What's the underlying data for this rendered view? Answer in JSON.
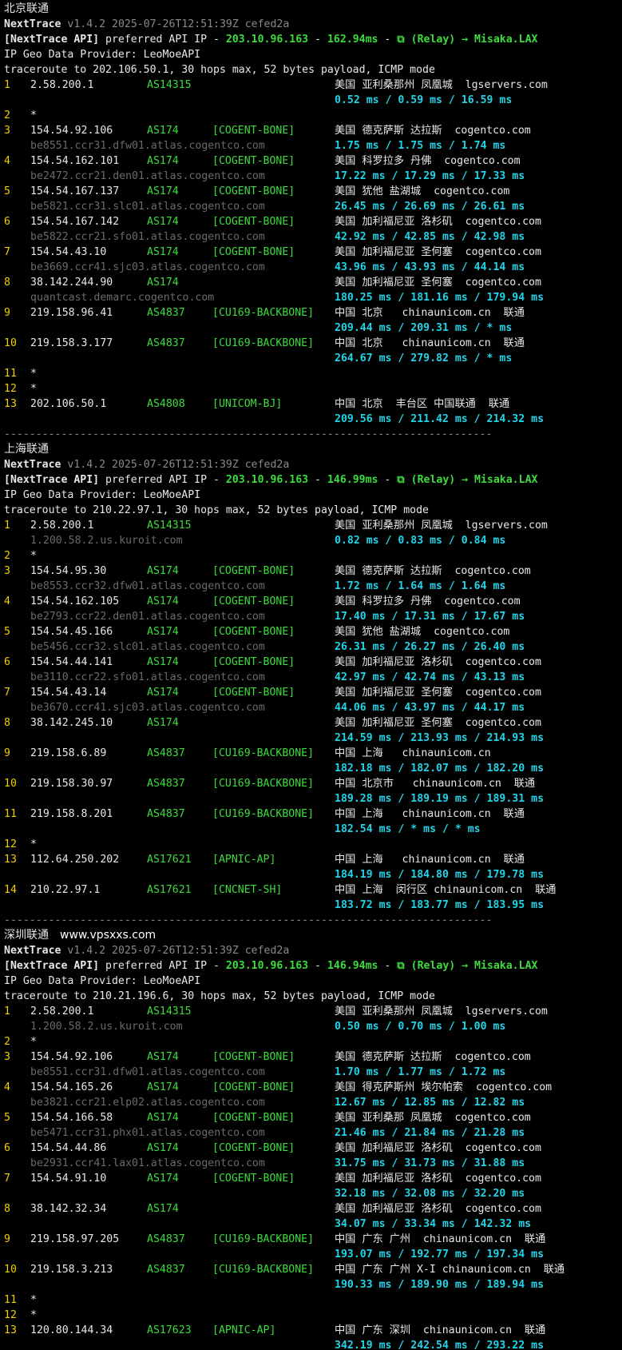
{
  "common": {
    "tool": "NextTrace",
    "version": "v1.4.2 2025-07-26T12:51:39Z cefed2a",
    "api_bracket": "[NextTrace API]",
    "api_text": " preferred API IP - ",
    "api_ip": "203.10.96.163",
    "api_dash": " - ",
    "relay": "⧉ (Relay) → Misaka.LAX",
    "geo_provider": "IP Geo Data Provider: LeoMoeAPI",
    "separator": "-----------------------------------------------------------------------------"
  },
  "sections": [
    {
      "title": "北京联通",
      "site": "",
      "latency": "162.94ms",
      "traceroute": "traceroute to 202.106.50.1, 30 hops max, 52 bytes payload, ICMP mode",
      "hops": [
        {
          "hop": "1",
          "ip": "2.58.200.1",
          "as": "AS14315",
          "tag": "",
          "geo": "美国 亚利桑那州 凤凰城  lgservers.com",
          "host": "",
          "rtt": "0.52 ms / 0.59 ms / 16.59 ms"
        },
        {
          "hop": "2",
          "ip": "*"
        },
        {
          "hop": "3",
          "ip": "154.54.92.106",
          "as": "AS174",
          "tag": "[COGENT-BONE]",
          "geo": "美国 德克萨斯 达拉斯  cogentco.com",
          "host": "be8551.ccr31.dfw01.atlas.cogentco.com",
          "rtt": "1.75 ms / 1.75 ms / 1.74 ms"
        },
        {
          "hop": "4",
          "ip": "154.54.162.101",
          "as": "AS174",
          "tag": "[COGENT-BONE]",
          "geo": "美国 科罗拉多 丹佛  cogentco.com",
          "host": "be2472.ccr21.den01.atlas.cogentco.com",
          "rtt": "17.22 ms / 17.29 ms / 17.33 ms"
        },
        {
          "hop": "5",
          "ip": "154.54.167.137",
          "as": "AS174",
          "tag": "[COGENT-BONE]",
          "geo": "美国 犹他 盐湖城  cogentco.com",
          "host": "be5821.ccr31.slc01.atlas.cogentco.com",
          "rtt": "26.45 ms / 26.69 ms / 26.61 ms"
        },
        {
          "hop": "6",
          "ip": "154.54.167.142",
          "as": "AS174",
          "tag": "[COGENT-BONE]",
          "geo": "美国 加利福尼亚 洛杉矶  cogentco.com",
          "host": "be5822.ccr21.sfo01.atlas.cogentco.com",
          "rtt": "42.92 ms / 42.85 ms / 42.98 ms"
        },
        {
          "hop": "7",
          "ip": "154.54.43.10",
          "as": "AS174",
          "tag": "[COGENT-BONE]",
          "geo": "美国 加利福尼亚 圣何塞  cogentco.com",
          "host": "be3669.ccr41.sjc03.atlas.cogentco.com",
          "rtt": "43.96 ms / 43.93 ms / 44.14 ms"
        },
        {
          "hop": "8",
          "ip": "38.142.244.90",
          "as": "AS174",
          "tag": "",
          "geo": "美国 加利福尼亚 圣何塞  cogentco.com",
          "host": "quantcast.demarc.cogentco.com",
          "rtt": "180.25 ms / 181.16 ms / 179.94 ms"
        },
        {
          "hop": "9",
          "ip": "219.158.96.41",
          "as": "AS4837",
          "tag": "[CU169-BACKBONE]",
          "geo": "中国 北京   chinaunicom.cn  联通",
          "host": "",
          "rtt": "209.44 ms / 209.31 ms / * ms"
        },
        {
          "hop": "10",
          "ip": "219.158.3.177",
          "as": "AS4837",
          "tag": "[CU169-BACKBONE]",
          "geo": "中国 北京   chinaunicom.cn  联通",
          "host": "",
          "rtt": "264.67 ms / 279.82 ms / * ms"
        },
        {
          "hop": "11",
          "ip": "*"
        },
        {
          "hop": "12",
          "ip": "*"
        },
        {
          "hop": "13",
          "ip": "202.106.50.1",
          "as": "AS4808",
          "tag": "[UNICOM-BJ]",
          "geo": "中国 北京  丰台区 中国联通  联通",
          "host": "",
          "rtt": "209.56 ms / 211.42 ms / 214.32 ms"
        }
      ]
    },
    {
      "title": "上海联通",
      "site": "",
      "latency": "146.99ms",
      "traceroute": "traceroute to 210.22.97.1, 30 hops max, 52 bytes payload, ICMP mode",
      "hops": [
        {
          "hop": "1",
          "ip": "2.58.200.1",
          "as": "AS14315",
          "tag": "",
          "geo": "美国 亚利桑那州 凤凰城  lgservers.com",
          "host": "1.200.58.2.us.kuroit.com",
          "rtt": "0.82 ms / 0.83 ms / 0.84 ms"
        },
        {
          "hop": "2",
          "ip": "*"
        },
        {
          "hop": "3",
          "ip": "154.54.95.30",
          "as": "AS174",
          "tag": "[COGENT-BONE]",
          "geo": "美国 德克萨斯 达拉斯  cogentco.com",
          "host": "be8553.ccr32.dfw01.atlas.cogentco.com",
          "rtt": "1.72 ms / 1.64 ms / 1.64 ms"
        },
        {
          "hop": "4",
          "ip": "154.54.162.105",
          "as": "AS174",
          "tag": "[COGENT-BONE]",
          "geo": "美国 科罗拉多 丹佛  cogentco.com",
          "host": "be2793.ccr22.den01.atlas.cogentco.com",
          "rtt": "17.40 ms / 17.31 ms / 17.67 ms"
        },
        {
          "hop": "5",
          "ip": "154.54.45.166",
          "as": "AS174",
          "tag": "[COGENT-BONE]",
          "geo": "美国 犹他 盐湖城  cogentco.com",
          "host": "be5456.ccr32.slc01.atlas.cogentco.com",
          "rtt": "26.31 ms / 26.27 ms / 26.40 ms"
        },
        {
          "hop": "6",
          "ip": "154.54.44.141",
          "as": "AS174",
          "tag": "[COGENT-BONE]",
          "geo": "美国 加利福尼亚 洛杉矶  cogentco.com",
          "host": "be3110.ccr22.sfo01.atlas.cogentco.com",
          "rtt": "42.97 ms / 42.74 ms / 43.13 ms"
        },
        {
          "hop": "7",
          "ip": "154.54.43.14",
          "as": "AS174",
          "tag": "[COGENT-BONE]",
          "geo": "美国 加利福尼亚 圣何塞  cogentco.com",
          "host": "be3670.ccr41.sjc03.atlas.cogentco.com",
          "rtt": "44.06 ms / 43.97 ms / 44.17 ms"
        },
        {
          "hop": "8",
          "ip": "38.142.245.10",
          "as": "AS174",
          "tag": "",
          "geo": "美国 加利福尼亚 圣何塞  cogentco.com",
          "host": "",
          "rtt": "214.59 ms / 213.93 ms / 214.93 ms"
        },
        {
          "hop": "9",
          "ip": "219.158.6.89",
          "as": "AS4837",
          "tag": "[CU169-BACKBONE]",
          "geo": "中国 上海   chinaunicom.cn",
          "host": "",
          "rtt": "182.18 ms / 182.07 ms / 182.20 ms"
        },
        {
          "hop": "10",
          "ip": "219.158.30.97",
          "as": "AS4837",
          "tag": "[CU169-BACKBONE]",
          "geo": "中国 北京市   chinaunicom.cn  联通",
          "host": "",
          "rtt": "189.28 ms / 189.19 ms / 189.31 ms"
        },
        {
          "hop": "11",
          "ip": "219.158.8.201",
          "as": "AS4837",
          "tag": "[CU169-BACKBONE]",
          "geo": "中国 上海   chinaunicom.cn  联通",
          "host": "",
          "rtt": "182.54 ms / * ms / * ms"
        },
        {
          "hop": "12",
          "ip": "*"
        },
        {
          "hop": "13",
          "ip": "112.64.250.202",
          "as": "AS17621",
          "tag": "[APNIC-AP]",
          "geo": "中国 上海   chinaunicom.cn  联通",
          "host": "",
          "rtt": "184.19 ms / 184.80 ms / 179.78 ms"
        },
        {
          "hop": "14",
          "ip": "210.22.97.1",
          "as": "AS17621",
          "tag": "[CNCNET-SH]",
          "geo": "中国 上海  闵行区 chinaunicom.cn  联通",
          "host": "",
          "rtt": "183.72 ms / 183.77 ms / 183.95 ms"
        }
      ]
    },
    {
      "title": "深圳联通",
      "site": "www.vpsxxs.com",
      "latency": "146.94ms",
      "traceroute": "traceroute to 210.21.196.6, 30 hops max, 52 bytes payload, ICMP mode",
      "hops": [
        {
          "hop": "1",
          "ip": "2.58.200.1",
          "as": "AS14315",
          "tag": "",
          "geo": "美国 亚利桑那州 凤凰城  lgservers.com",
          "host": "1.200.58.2.us.kuroit.com",
          "rtt": "0.50 ms / 0.70 ms / 1.00 ms"
        },
        {
          "hop": "2",
          "ip": "*"
        },
        {
          "hop": "3",
          "ip": "154.54.92.106",
          "as": "AS174",
          "tag": "[COGENT-BONE]",
          "geo": "美国 德克萨斯 达拉斯  cogentco.com",
          "host": "be8551.ccr31.dfw01.atlas.cogentco.com",
          "rtt": "1.70 ms / 1.77 ms / 1.72 ms"
        },
        {
          "hop": "4",
          "ip": "154.54.165.26",
          "as": "AS174",
          "tag": "[COGENT-BONE]",
          "geo": "美国 得克萨斯州 埃尔帕索  cogentco.com",
          "host": "be3821.ccr21.elp02.atlas.cogentco.com",
          "rtt": "12.67 ms / 12.85 ms / 12.82 ms"
        },
        {
          "hop": "5",
          "ip": "154.54.166.58",
          "as": "AS174",
          "tag": "[COGENT-BONE]",
          "geo": "美国 亚利桑那 凤凰城  cogentco.com",
          "host": "be5471.ccr31.phx01.atlas.cogentco.com",
          "rtt": "21.46 ms / 21.84 ms / 21.28 ms"
        },
        {
          "hop": "6",
          "ip": "154.54.44.86",
          "as": "AS174",
          "tag": "[COGENT-BONE]",
          "geo": "美国 加利福尼亚 洛杉矶  cogentco.com",
          "host": "be2931.ccr41.lax01.atlas.cogentco.com",
          "rtt": "31.75 ms / 31.73 ms / 31.88 ms"
        },
        {
          "hop": "7",
          "ip": "154.54.91.10",
          "as": "AS174",
          "tag": "[COGENT-BONE]",
          "geo": "美国 加利福尼亚 洛杉矶  cogentco.com",
          "host": "",
          "rtt": "32.18 ms / 32.08 ms / 32.20 ms"
        },
        {
          "hop": "8",
          "ip": "38.142.32.34",
          "as": "AS174",
          "tag": "",
          "geo": "美国 加利福尼亚 洛杉矶  cogentco.com",
          "host": "",
          "rtt": "34.07 ms / 33.34 ms / 142.32 ms"
        },
        {
          "hop": "9",
          "ip": "219.158.97.205",
          "as": "AS4837",
          "tag": "[CU169-BACKBONE]",
          "geo": "中国 广东 广州  chinaunicom.cn  联通",
          "host": "",
          "rtt": "193.07 ms / 192.77 ms / 197.34 ms"
        },
        {
          "hop": "10",
          "ip": "219.158.3.213",
          "as": "AS4837",
          "tag": "[CU169-BACKBONE]",
          "geo": "中国 广东 广州 X-I chinaunicom.cn  联通",
          "host": "",
          "rtt": "190.33 ms / 189.90 ms / 189.94 ms"
        },
        {
          "hop": "11",
          "ip": "*"
        },
        {
          "hop": "12",
          "ip": "*"
        },
        {
          "hop": "13",
          "ip": "120.80.144.34",
          "as": "AS17623",
          "tag": "[APNIC-AP]",
          "geo": "中国 广东 深圳  chinaunicom.cn  联通",
          "host": "",
          "rtt": "342.19 ms / 242.54 ms / 293.22 ms"
        }
      ]
    }
  ]
}
